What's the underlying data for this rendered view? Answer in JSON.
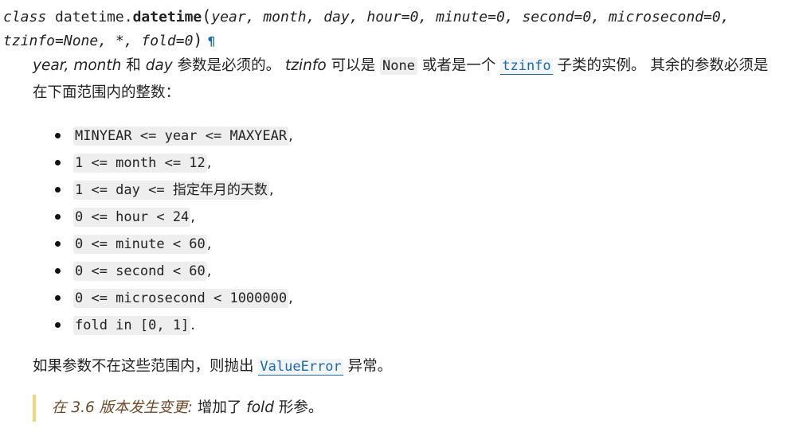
{
  "signature": {
    "keyword": "class",
    "module": "datetime.",
    "name": "datetime",
    "open_paren": "(",
    "params_line1": "year, month, day, hour=0, minute=0, second=0, microsecond=0,",
    "params_line2": "tzinfo=None, *, fold=0",
    "close_paren": ")",
    "anchor": "¶"
  },
  "intro": {
    "p1": "year, month",
    "p2": "和",
    "p3": "day",
    "p4": "参数是必须的。",
    "p5": "tzinfo",
    "p6": "可以是",
    "none_code": "None",
    "p7": "或者是一个",
    "tzinfo_link": "tzinfo",
    "p8": "子类的实例。 其余的参数必须是",
    "line2": "在下面范围内的整数："
  },
  "constraints": [
    {
      "code": "MINYEAR <= year <= MAXYEAR",
      "suffix": ","
    },
    {
      "code": "1 <= month <= 12",
      "suffix": ","
    },
    {
      "code": "1 <= day <= 指定年月的天数",
      "suffix": ","
    },
    {
      "code": "0 <= hour < 24",
      "suffix": ","
    },
    {
      "code": "0 <= minute < 60",
      "suffix": ","
    },
    {
      "code": "0 <= second < 60",
      "suffix": ","
    },
    {
      "code": "0 <= microsecond < 1000000",
      "suffix": ","
    },
    {
      "code": "fold in [0, 1]",
      "suffix": "."
    }
  ],
  "error_note": {
    "before": "如果参数不在这些范围内，则抛出",
    "link": "ValueError",
    "after": "异常。"
  },
  "version_changed": {
    "label": "在 3.6 版本发生变更:",
    "before": "增加了",
    "param": "fold",
    "after": "形参。"
  }
}
